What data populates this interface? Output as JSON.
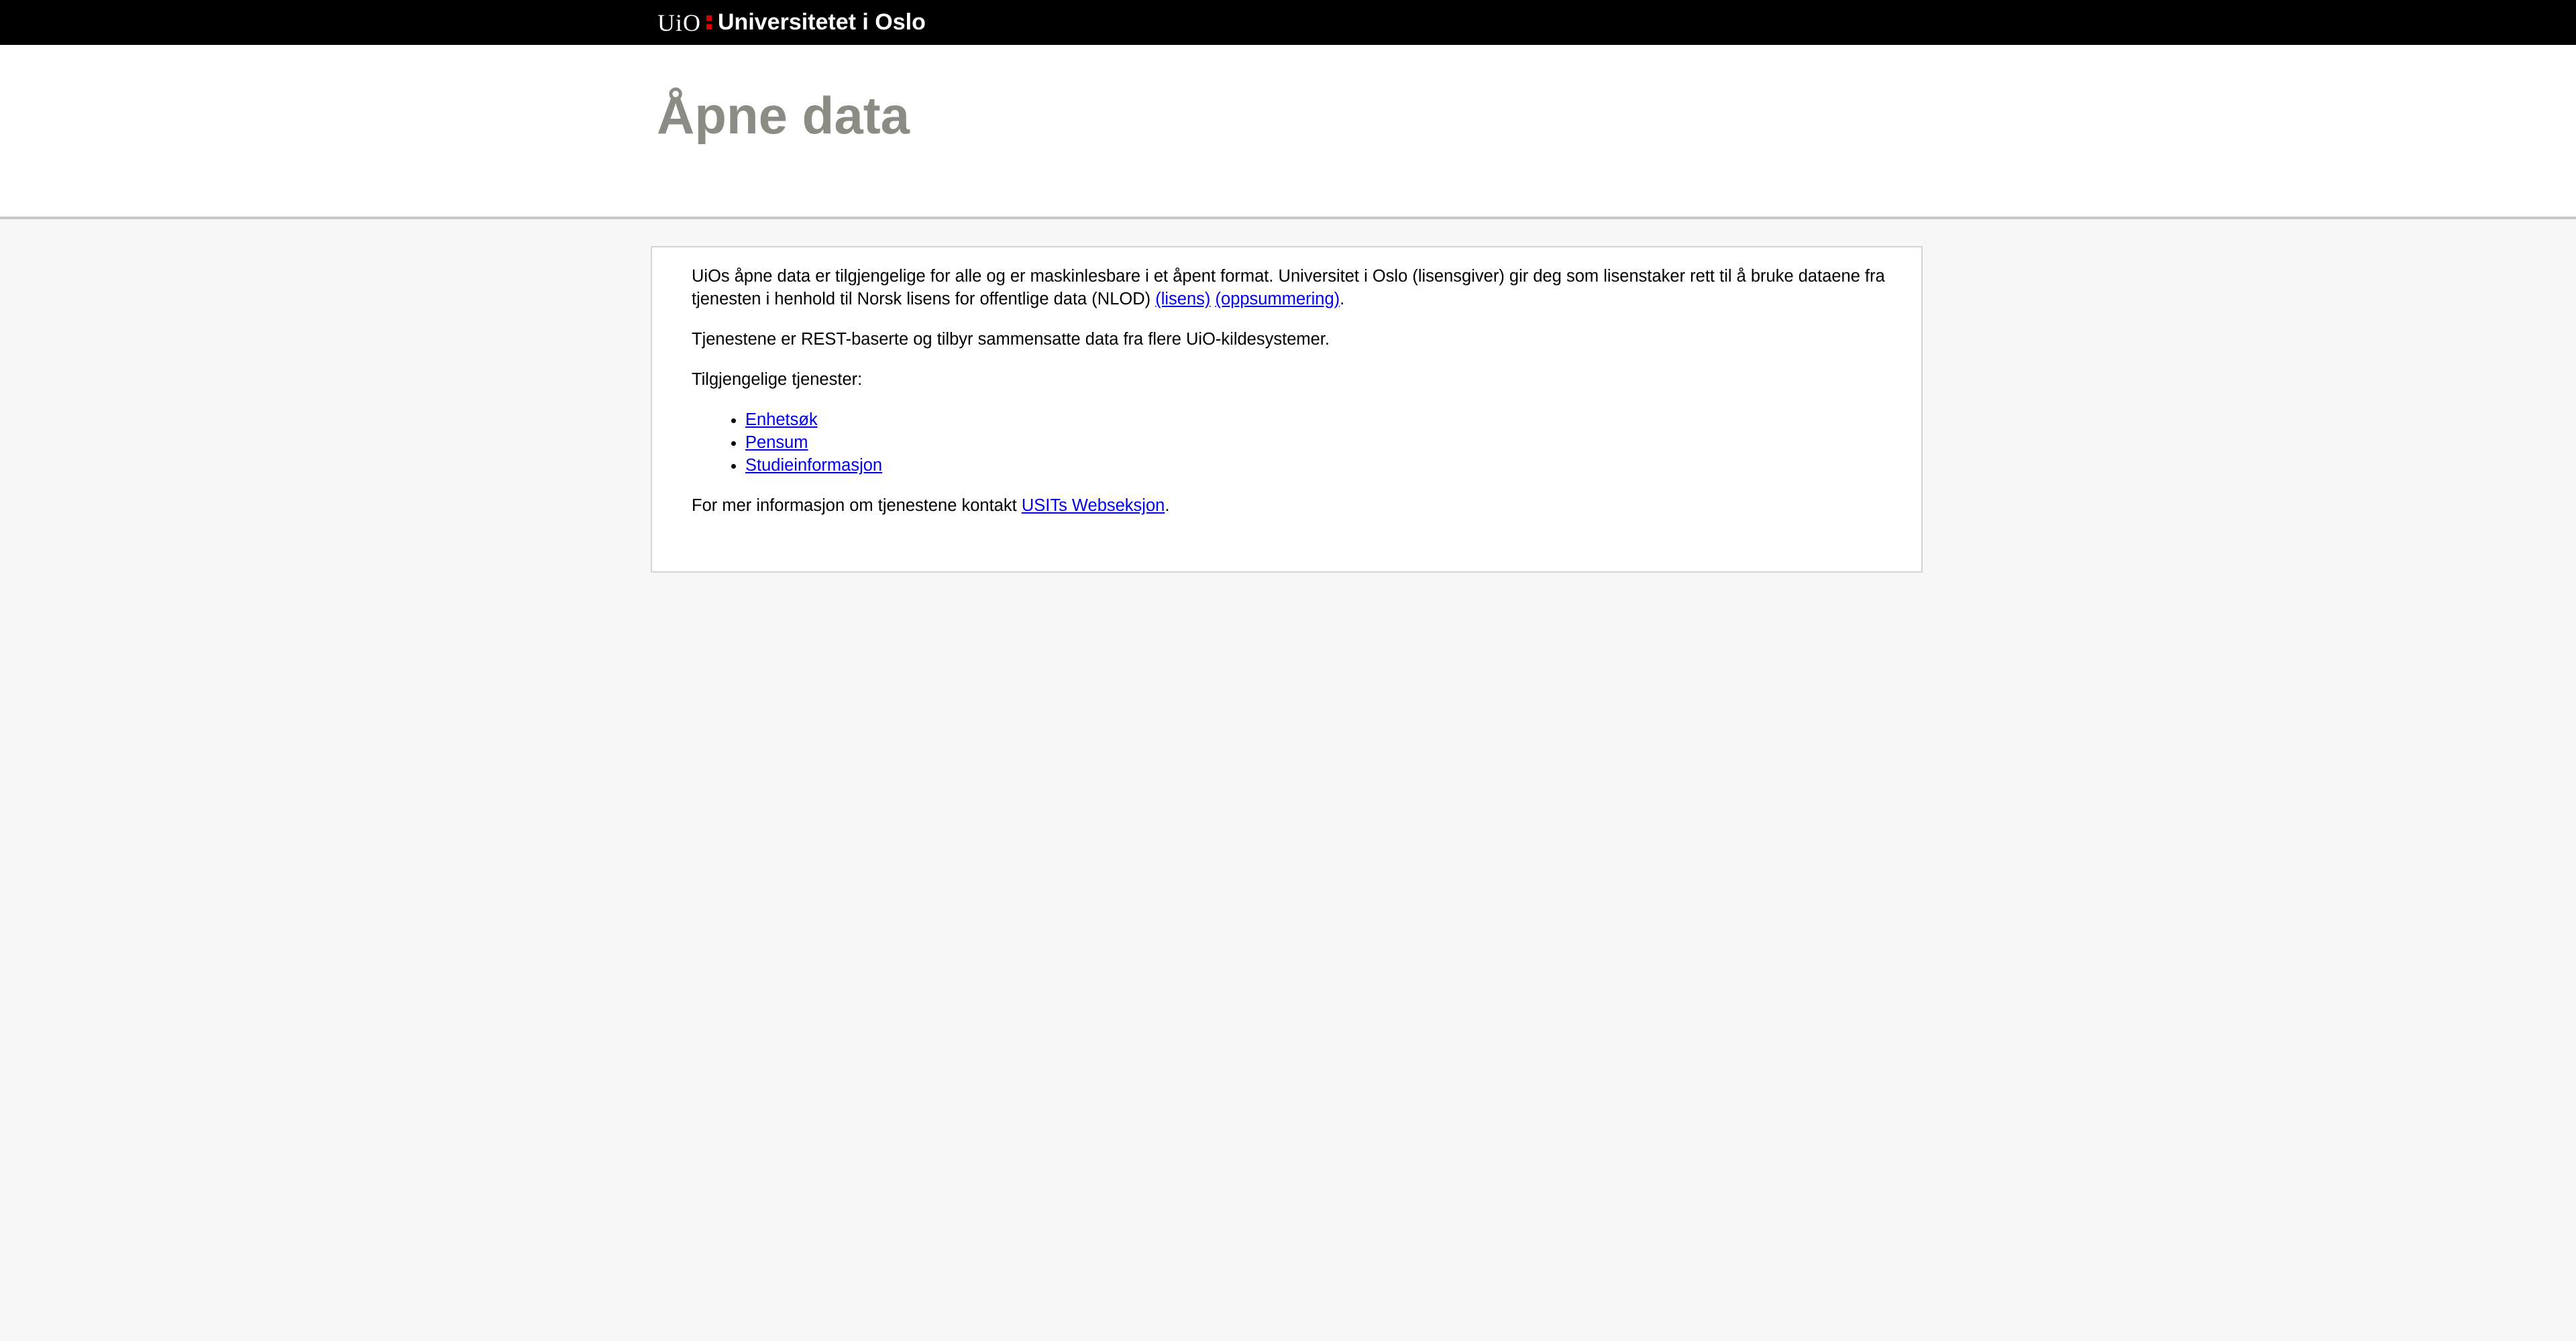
{
  "topbar": {
    "logo_short": "UiO",
    "logo_name": "Universitetet i Oslo",
    "accent_color": "#dd0000"
  },
  "header": {
    "title": "Åpne data"
  },
  "main": {
    "intro_text": "UiOs åpne data er tilgjengelige for alle og er maskinlesbare i et åpent format. Universitet i Oslo (lisensgiver) gir deg som lisenstaker rett til å bruke dataene fra tjenesten i henhold til Norsk lisens for offentlige data (NLOD)",
    "license_link": "(lisens)",
    "summary_link": "(oppsummering)",
    "intro_end": ".",
    "rest_text": "Tjenestene er REST-baserte og tilbyr sammensatte data fra flere UiO-kildesystemer.",
    "services_heading": "Tilgjengelige tjenester:",
    "services": [
      {
        "label": "Enhetsøk"
      },
      {
        "label": "Pensum"
      },
      {
        "label": "Studieinformasjon"
      }
    ],
    "contact_text": "For mer informasjon om tjenestene kontakt",
    "contact_link": "USITs Webseksjon",
    "contact_end": "."
  }
}
